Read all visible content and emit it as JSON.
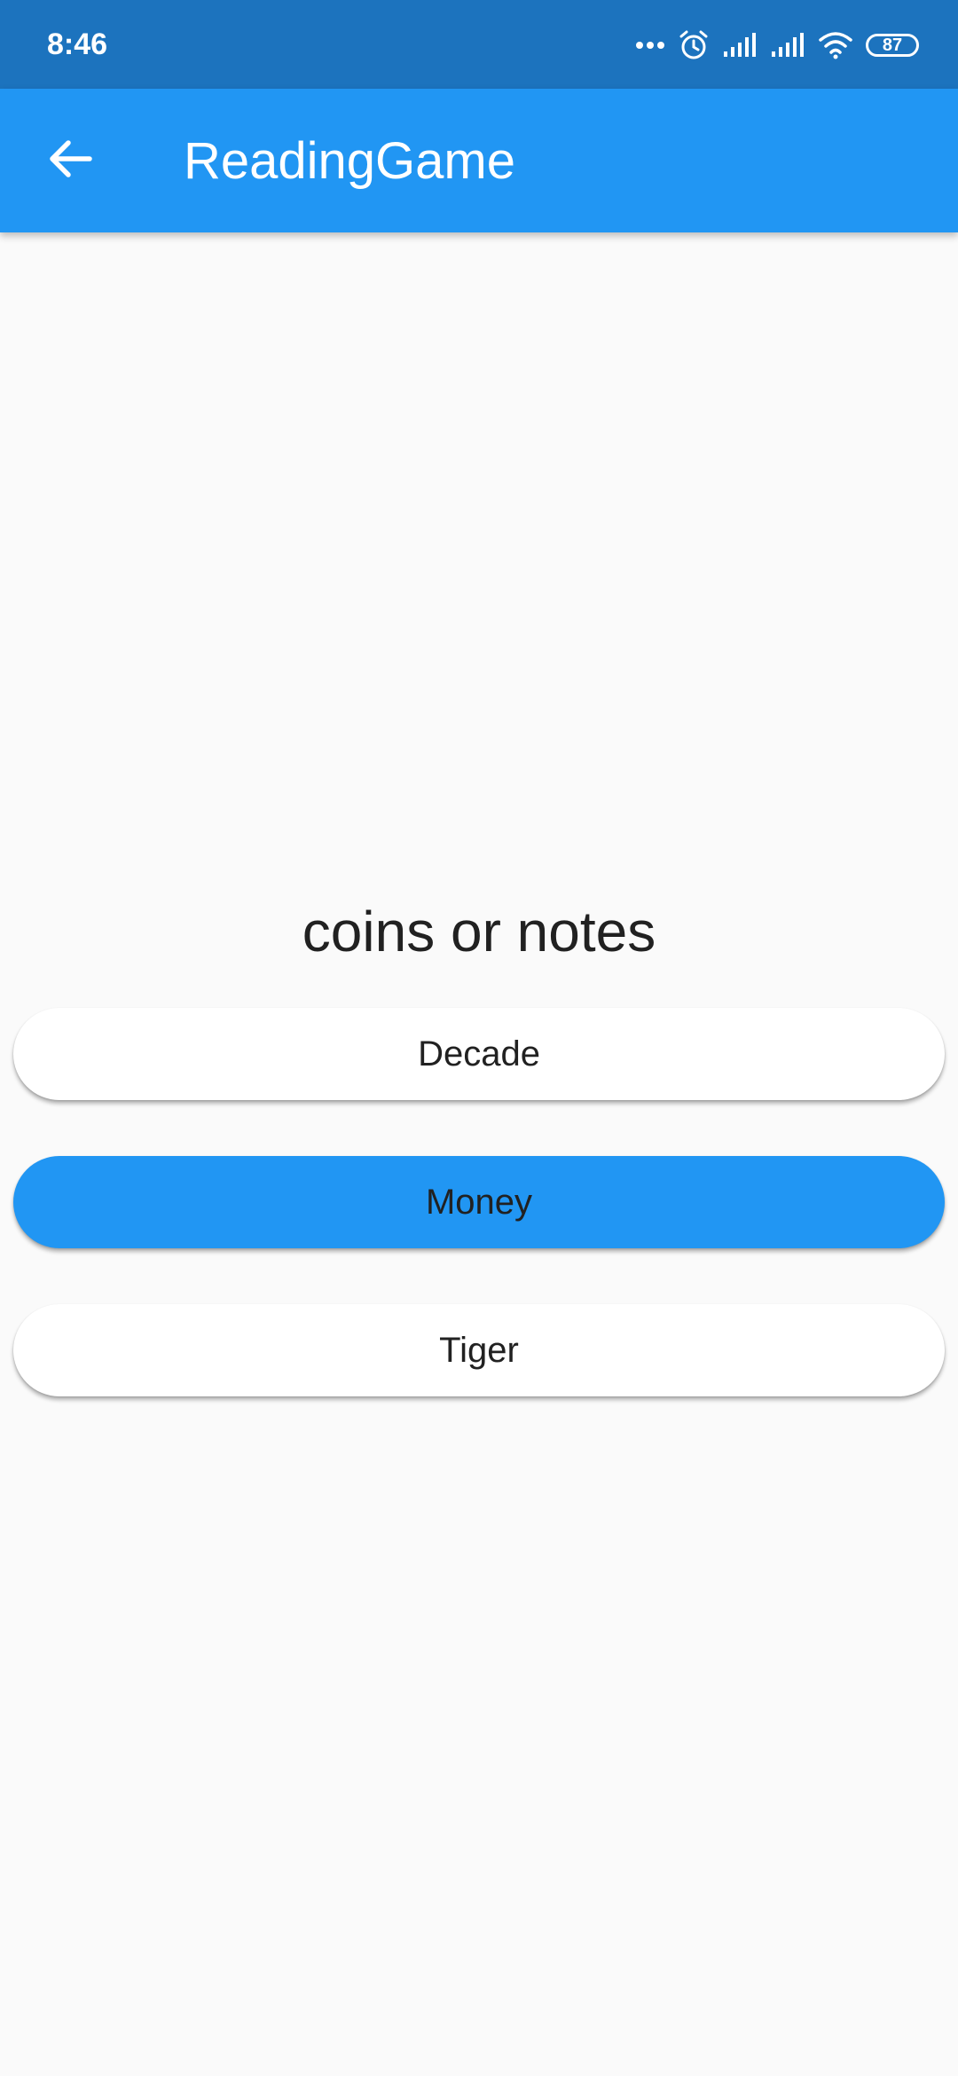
{
  "status_bar": {
    "time": "8:46",
    "battery": "87",
    "icons": [
      "more-dots-icon",
      "alarm-icon",
      "signal-icon",
      "signal-icon",
      "wifi-icon",
      "battery-icon"
    ]
  },
  "app_bar": {
    "title": "ReadingGame",
    "back_icon": "arrow-back-icon",
    "color": "#2196f3"
  },
  "game": {
    "prompt": "coins or notes",
    "options": [
      {
        "label": "Decade",
        "selected": false
      },
      {
        "label": "Money",
        "selected": true
      },
      {
        "label": "Tiger",
        "selected": false
      }
    ]
  },
  "colors": {
    "status_bar": "#1c73be",
    "accent": "#2196f3",
    "background": "#fafafa"
  }
}
